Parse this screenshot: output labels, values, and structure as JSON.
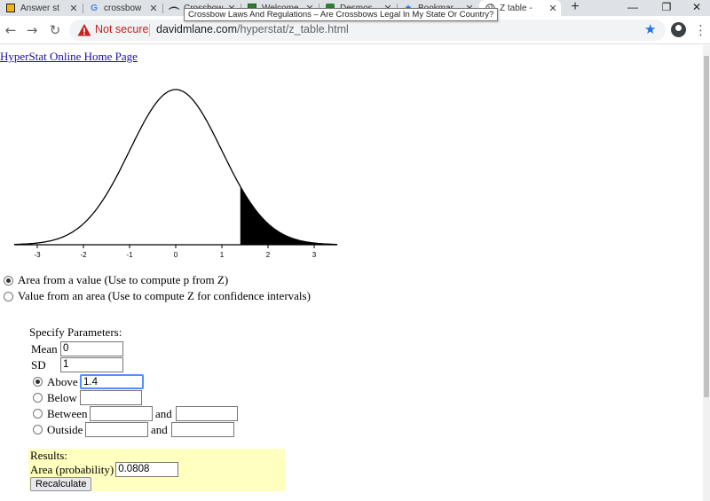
{
  "browser": {
    "tabs": [
      {
        "label": "Answer st",
        "favicon": "answer-site-icon",
        "favicon_color": "#f4b400",
        "active": false
      },
      {
        "label": "crossbow",
        "favicon": "google-icon",
        "favicon_color": "#4285f4",
        "active": false
      },
      {
        "label": "Crossbow",
        "favicon": "crossbow-icon",
        "favicon_color": "#333333",
        "active": false
      },
      {
        "label": "Welcome",
        "favicon": "welcome-site-icon",
        "favicon_color": "#2e7d32",
        "active": false
      },
      {
        "label": "Desmos",
        "favicon": "desmos-icon",
        "favicon_color": "#2e7d32",
        "active": false
      },
      {
        "label": "Bookmar",
        "favicon": "star-icon",
        "favicon_color": "#1a73e8",
        "active": false
      },
      {
        "label": "Z table -",
        "favicon": "globe-icon",
        "favicon_color": "#5f6368",
        "active": true
      }
    ],
    "tooltip": "Crossbow Laws And Regulations – Are Crossbows Legal In My State Or Country?",
    "security_label": "Not secure",
    "url_host": "davidmlane.com",
    "url_path": "/hyperstat/z_table.html",
    "accent_color": "#1a73e8",
    "warning_color": "#c5221f"
  },
  "page": {
    "home_link": "HyperStat Online Home Page",
    "chart_data": {
      "type": "area",
      "distribution": "normal",
      "mean": 0,
      "sd": 1,
      "x_ticks": [
        "-3",
        "-2",
        "-1",
        "0",
        "1",
        "2",
        "3"
      ],
      "xlim": [
        -3.5,
        3.5
      ],
      "shaded_region": {
        "from": 1.4,
        "to": 3.5
      },
      "shade_color": "#000000"
    },
    "modes": [
      {
        "label": "Area from a value (Use to compute p from Z)",
        "checked": true
      },
      {
        "label": "Value from an area (Use to compute Z for confidence intervals)",
        "checked": false
      }
    ],
    "params": {
      "title": "Specify Parameters:",
      "mean_label": "Mean",
      "mean_value": "0",
      "sd_label": "SD",
      "sd_value": "1",
      "above_label": "Above",
      "above_value": "1.4",
      "below_label": "Below",
      "between_label": "Between",
      "outside_label": "Outside",
      "and_label": "and",
      "selected": "above"
    },
    "results": {
      "title": "Results:",
      "area_label": "Area (probability)",
      "area_value": "0.0808",
      "recalc_label": "Recalculate",
      "background": "#ffffc0"
    }
  }
}
